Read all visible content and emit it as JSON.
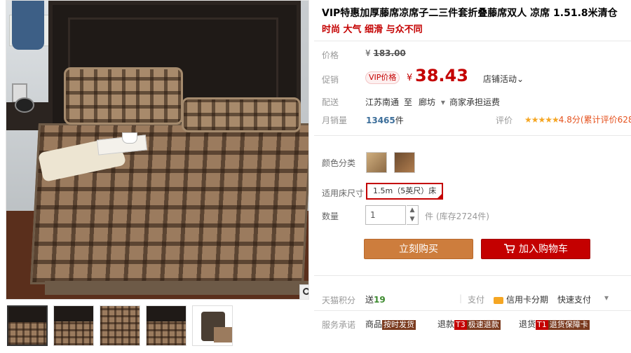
{
  "product": {
    "title": "VIP特惠加厚藤席凉席子二三件套折叠藤席双人 凉席 1.51.8米清仓",
    "subtitle": "时尚 大气 细滑 与众不同"
  },
  "price": {
    "label": "价格",
    "currency": "¥",
    "original": "183.00",
    "promo_label": "促销",
    "vip_badge": "VIP价格",
    "promo_price": "38.43",
    "store_promo": "店铺活动",
    "chevron": "⌄"
  },
  "shipping": {
    "label": "配送",
    "from": "江苏南通",
    "to_word": "至",
    "to": "廊坊",
    "dropdown": "▾",
    "note": "商家承担运费"
  },
  "sales": {
    "label": "月销量",
    "count": "13465",
    "unit": "件",
    "rating_label": "评价",
    "stars": "★★★★★",
    "score": "4.8分",
    "reviews": "(累计评价628"
  },
  "options": {
    "color_label": "颜色分类",
    "size_label": "适用床尺寸",
    "size_value": "1.5m（5英尺）床",
    "qty_label": "数量",
    "qty_value": "1",
    "qty_unit": "件",
    "stock": "(库存2724件)",
    "up": "▲",
    "down": "▼"
  },
  "actions": {
    "buy": "立刻购买",
    "cart": "加入购物车"
  },
  "points": {
    "label": "天猫积分",
    "prefix": "送",
    "value": "19",
    "pay_label": "支付",
    "credit": "信用卡分期",
    "quick": "快速支付",
    "more": "▾"
  },
  "service": {
    "label": "服务承诺",
    "goods": "商品",
    "goods_tag": "按时发货",
    "refund": "退款",
    "refund_tag_prefix": "T3",
    "refund_tag": "极速退款",
    "return": "退货",
    "return_tag_prefix": "T1",
    "return_tag": "退货保障卡"
  },
  "icons": {
    "zoom": "search-icon",
    "cart": "cart-icon",
    "card": "credit-card-icon"
  },
  "colors": {
    "accent_red": "#c40000",
    "buy_orange": "#cd7d3d"
  }
}
